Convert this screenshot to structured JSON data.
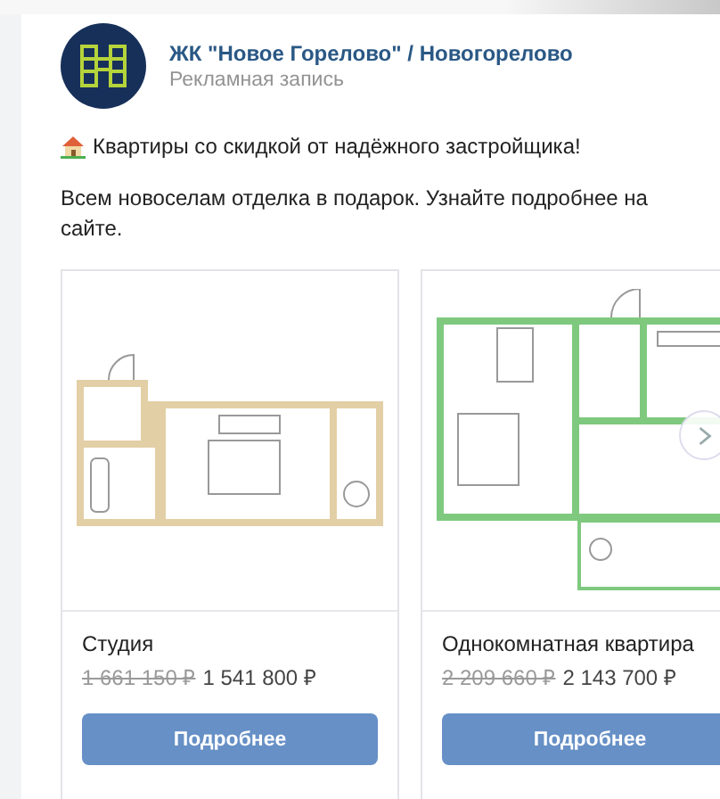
{
  "post": {
    "author": "ЖК \"Новое Горелово\" / Новогорелово",
    "subtitle": "Рекламная запись",
    "headline": "Квартиры со скидкой от надёжного застройщика!",
    "text": "Всем новоселам отделка в подарок. Узнайте подробнее на сайте."
  },
  "carousel": {
    "items": [
      {
        "kind": "studio",
        "title": "Студия",
        "old_price": "1 661 150 ₽",
        "price": "1 541 800 ₽",
        "button": "Подробнее"
      },
      {
        "kind": "one-room",
        "title": "Однокомнатная квартира",
        "old_price": "2 209 660 ₽",
        "price": "2 143 700 ₽",
        "button": "Подробнее"
      }
    ]
  }
}
